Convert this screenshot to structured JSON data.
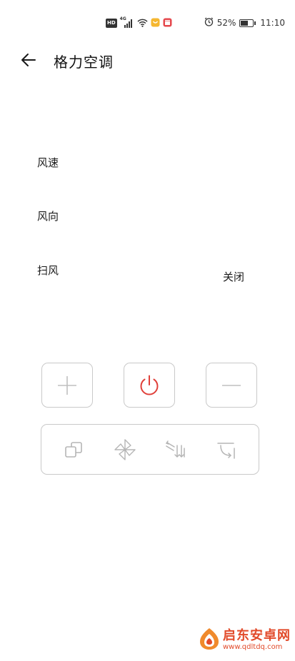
{
  "status_bar": {
    "hd_label": "HD",
    "network_label": "4G",
    "battery_percent": "52%",
    "battery_level": 0.52,
    "time": "11:10",
    "icons": [
      "hd-icon",
      "signal-icon",
      "wifi-icon",
      "app-notification-icon",
      "calendar-notification-icon",
      "alarm-icon",
      "battery-icon"
    ]
  },
  "header": {
    "title": "格力空调",
    "back_icon": "arrow-left-icon"
  },
  "settings": {
    "fan_speed_label": "风速",
    "fan_direction_label": "风向",
    "swing_label": "扫风",
    "swing_value": "关闭"
  },
  "controls": {
    "increase_icon": "plus-icon",
    "power_icon": "power-icon",
    "decrease_icon": "minus-icon",
    "mode_buttons": [
      "mode-icon",
      "fan-speed-icon",
      "swing-icon",
      "fan-direction-icon"
    ],
    "power_color": "#e0403a",
    "border_color": "#c9c9c9",
    "icon_color": "#bfbfbf"
  },
  "watermark": {
    "name": "启东安卓网",
    "url": "www.qdltdq.com",
    "color": "#e24a2a"
  }
}
